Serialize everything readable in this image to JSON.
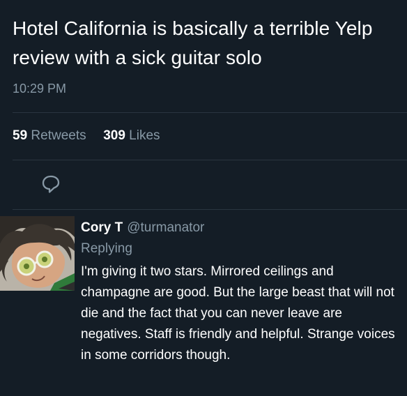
{
  "tweet": {
    "text": "Hotel California is basically a terrible Yelp review with a sick guitar solo",
    "time": "10:29 PM",
    "retweets_count": "59",
    "retweets_label": "Retweets",
    "likes_count": "309",
    "likes_label": "Likes"
  },
  "icons": {
    "reply": "reply-icon"
  },
  "reply": {
    "name": "Cory T",
    "handle": "@turmanator",
    "subtitle": "Replying",
    "text": "I'm giving it two stars. Mirrored ceilings and champagne are good. But the large beast that will not die and the fact that you can never leave are negatives. Staff is friendly and helpful. Strange voices in some corridors though."
  },
  "colors": {
    "background": "#141d26",
    "text_primary": "#ffffff",
    "text_secondary": "#8899a6",
    "divider": "#2a3540"
  }
}
